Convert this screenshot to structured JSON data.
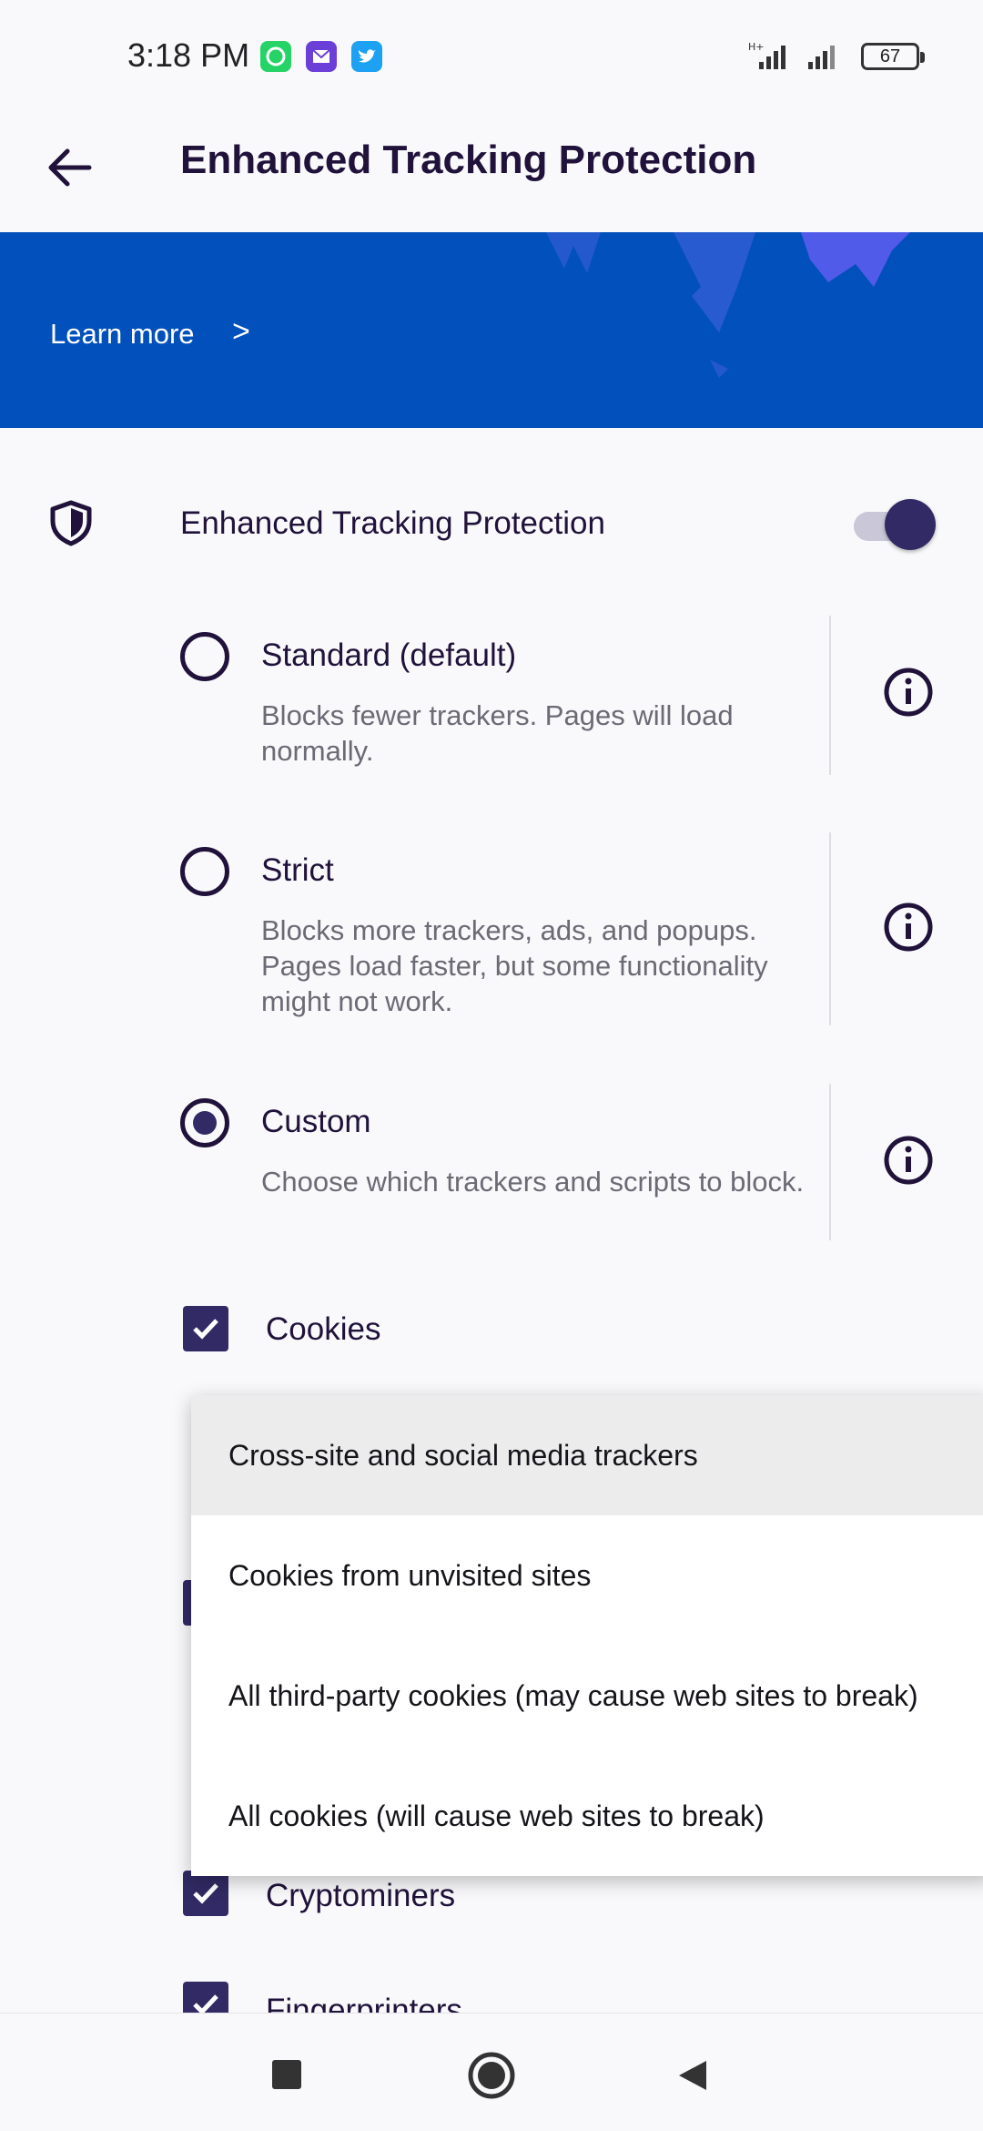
{
  "status_bar": {
    "time": "3:18 PM",
    "battery": "67",
    "icons": [
      "whatsapp-icon",
      "mail-icon",
      "twitter-icon",
      "signal-icon",
      "signal-icon",
      "battery-icon"
    ]
  },
  "toolbar": {
    "title": "Enhanced Tracking Protection"
  },
  "banner": {
    "learn_more": "Learn more",
    "chevron": ">"
  },
  "main_toggle": {
    "label": "Enhanced Tracking Protection",
    "enabled": true
  },
  "modes": [
    {
      "title": "Standard (default)",
      "desc": "Blocks fewer trackers. Pages will load normally.",
      "selected": false
    },
    {
      "title": "Strict",
      "desc": "Blocks more trackers, ads, and popups. Pages load faster, but some functionality might not work.",
      "selected": false
    },
    {
      "title": "Custom",
      "desc": "Choose which trackers and scripts to block.",
      "selected": true
    }
  ],
  "custom_options": [
    {
      "label": "Cookies",
      "checked": true
    },
    {
      "label": "Cryptominers",
      "checked": true
    },
    {
      "label": "Fingerprinters",
      "checked": true
    }
  ],
  "cookies_menu": {
    "items": [
      "Cross-site and social media trackers",
      "Cookies from unvisited sites",
      "All third-party cookies (may cause web sites to break)",
      "All cookies (will cause web sites to break)"
    ],
    "highlighted_index": 0
  },
  "colors": {
    "accent": "#312a64",
    "banner": "#0250bb",
    "background": "#f9f9fb"
  }
}
